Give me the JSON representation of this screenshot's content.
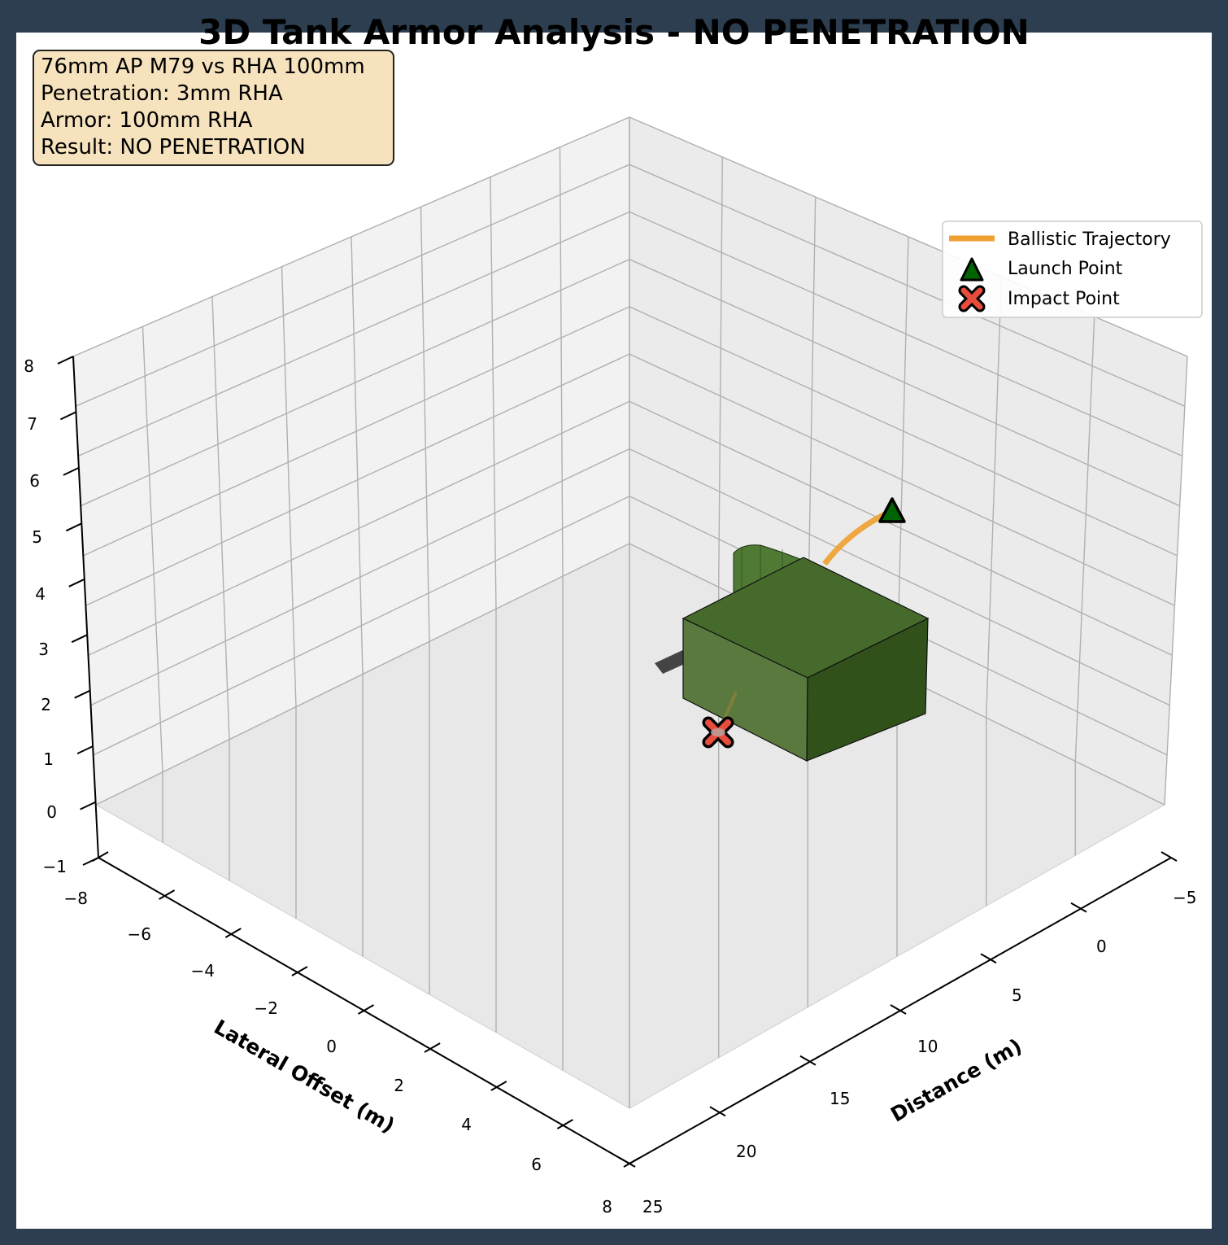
{
  "chart_data": {
    "type": "3d-line",
    "title": "3D Tank Armor Analysis - NO PENETRATION",
    "xlabel": "Distance (m)",
    "ylabel": "Lateral Offset (m)",
    "zlabel": "",
    "xlim": [
      -5,
      25
    ],
    "ylim": [
      -8,
      8
    ],
    "zlim": [
      -1,
      8
    ],
    "x_ticks": [
      "−5",
      "0",
      "5",
      "10",
      "15",
      "20",
      "25"
    ],
    "y_ticks": [
      "−8",
      "−6",
      "−4",
      "−2",
      "0",
      "2",
      "4",
      "6",
      "8"
    ],
    "z_ticks": [
      "−1",
      "0",
      "1",
      "2",
      "3",
      "4",
      "5",
      "6",
      "7",
      "8"
    ],
    "grid": true,
    "legend_position": "upper right",
    "series": [
      {
        "name": "Ballistic Trajectory",
        "kind": "line",
        "color": "#f0a030"
      },
      {
        "name": "Launch Point",
        "kind": "marker",
        "marker": "triangle",
        "color": "#006400"
      },
      {
        "name": "Impact Point",
        "kind": "marker",
        "marker": "x",
        "color": "#e74c3c"
      }
    ],
    "info_box": [
      "76mm AP M79 vs RHA 100mm",
      "Penetration: 3mm RHA",
      "Armor: 100mm RHA",
      "Result: NO PENETRATION"
    ],
    "tank_color": "#3a5f1f"
  }
}
